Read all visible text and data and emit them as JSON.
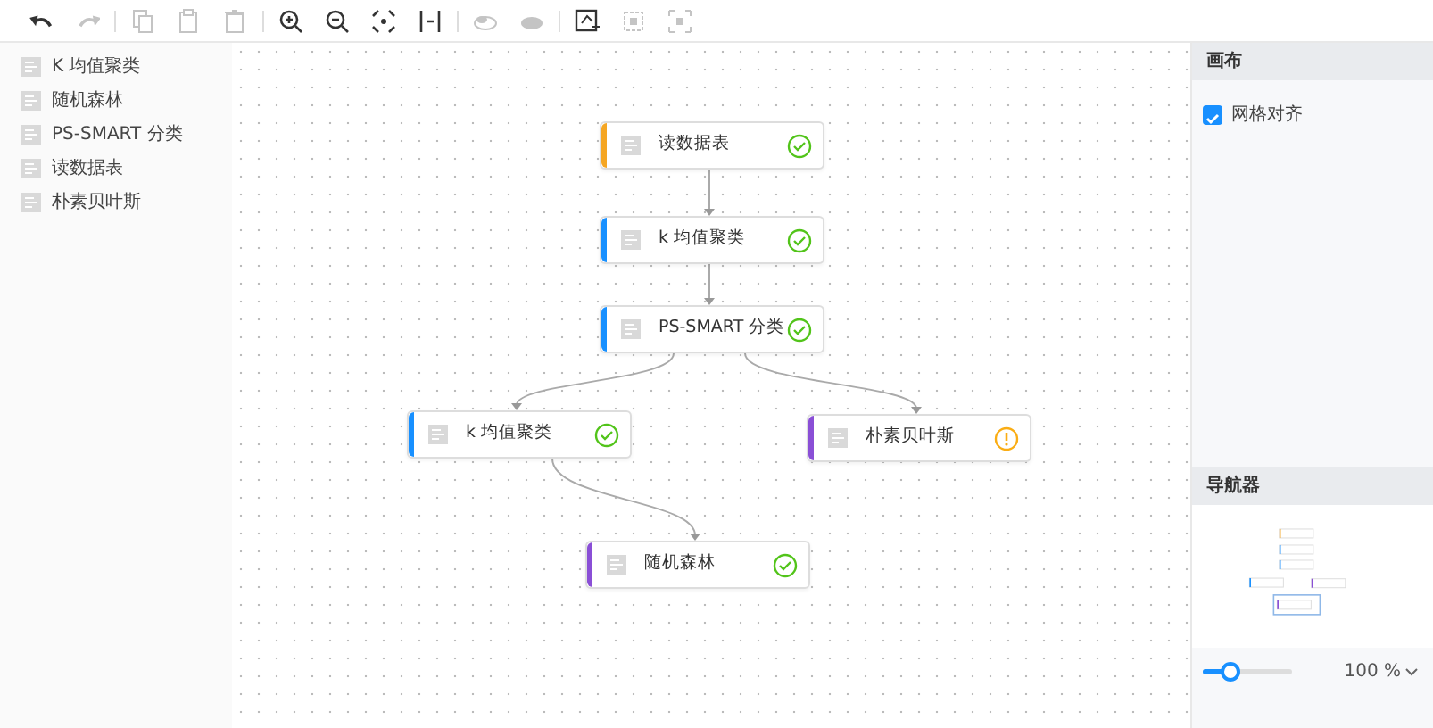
{
  "toolbar": [
    {
      "kind": "undo",
      "disabled": false
    },
    {
      "kind": "redo",
      "disabled": true
    },
    {
      "kind": "sep"
    },
    {
      "kind": "copy",
      "disabled": true
    },
    {
      "kind": "paste",
      "disabled": true
    },
    {
      "kind": "delete",
      "disabled": true
    },
    {
      "kind": "sep"
    },
    {
      "kind": "zoom-in",
      "disabled": false
    },
    {
      "kind": "zoom-out",
      "disabled": false
    },
    {
      "kind": "fit",
      "disabled": false
    },
    {
      "kind": "actual",
      "disabled": false
    },
    {
      "kind": "sep"
    },
    {
      "kind": "group",
      "disabled": true
    },
    {
      "kind": "ungroup",
      "disabled": true
    },
    {
      "kind": "sep"
    },
    {
      "kind": "select-all",
      "disabled": false
    },
    {
      "kind": "align",
      "disabled": true
    },
    {
      "kind": "align2",
      "disabled": true
    }
  ],
  "components": [
    {
      "label": "K 均值聚类"
    },
    {
      "label": "随机森林"
    },
    {
      "label": "PS-SMART 分类"
    },
    {
      "label": "读数据表"
    },
    {
      "label": "朴素贝叶斯"
    }
  ],
  "canvas": {
    "nodes": [
      {
        "label": "读数据表",
        "color": "#f5a623",
        "kind": "success"
      },
      {
        "label": "k 均值聚类",
        "color": "#1890ff",
        "kind": "success"
      },
      {
        "label": "PS-SMART 分类",
        "color": "#1890ff",
        "kind": "success"
      },
      {
        "label": "k 均值聚类",
        "color": "#1890ff",
        "kind": "success"
      },
      {
        "label": "朴素贝叶斯",
        "color": "#8a4fd6",
        "kind": "warning"
      },
      {
        "label": "随机森林",
        "color": "#8a4fd6",
        "kind": "success"
      }
    ]
  },
  "canvas_panel": {
    "title": "画布",
    "grid_snap": {
      "label": "网格对齐",
      "checked": true
    }
  },
  "navigator": {
    "title": "导航器",
    "zoom": {
      "level": 0.3,
      "value": "100 %"
    }
  }
}
